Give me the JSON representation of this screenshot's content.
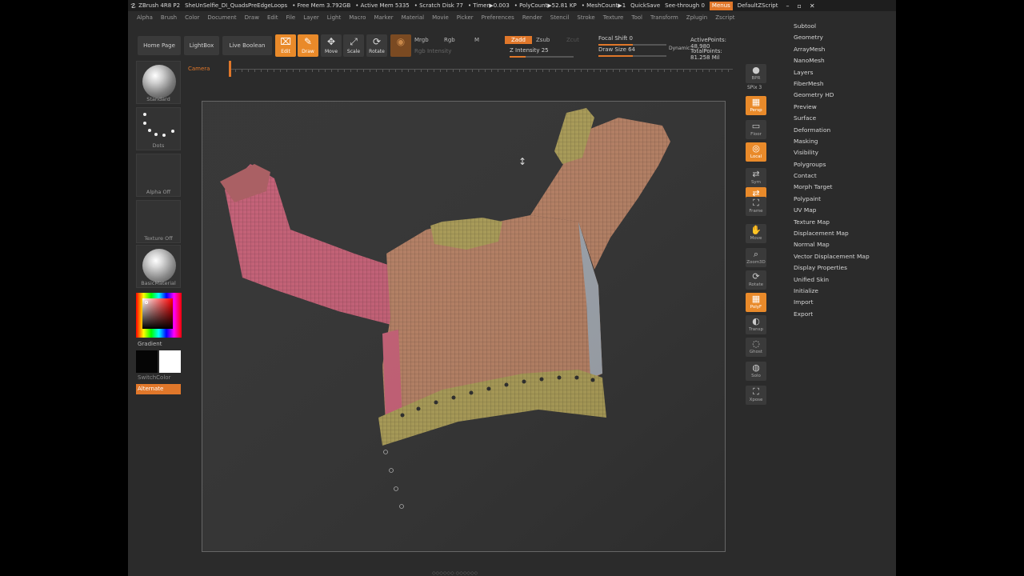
{
  "titlebar": {
    "app": "ZBrush 4R8 P2",
    "file": "SheUnSelfie_DI_QuadsPreEdgeLoops",
    "free_mem": "• Free Mem 3.792GB",
    "active_mem": "• Active Mem 5335",
    "scratch": "• Scratch Disk 77",
    "timer": "• Timer▶0.003",
    "polycount": "• PolyCount▶52.81 KP",
    "meshcount": "• MeshCount▶1",
    "quicksave": "QuickSave",
    "see_through": "See-through  0",
    "menus": "Menus",
    "script": "DefaultZScript"
  },
  "menubar": [
    "Alpha",
    "Brush",
    "Color",
    "Document",
    "Draw",
    "Edit",
    "File",
    "Layer",
    "Light",
    "Macro",
    "Marker",
    "Material",
    "Movie",
    "Picker",
    "Preferences",
    "Render",
    "Stencil",
    "Stroke",
    "Texture",
    "Tool",
    "Transform",
    "Zplugin",
    "Zscript"
  ],
  "toolbar": {
    "home_page": "Home Page",
    "lightbox": "LightBox",
    "live_boolean": "Live Boolean",
    "edit": "Edit",
    "draw": "Draw",
    "move": "Move",
    "scale": "Scale",
    "rotate": "Rotate",
    "mrgb": "Mrgb",
    "rgb": "Rgb",
    "m": "M",
    "rgb_intensity": "Rgb Intensity",
    "zadd": "Zadd",
    "zsub": "Zsub",
    "zcut": "Zcut",
    "z_intensity": "Z Intensity 25",
    "focal_shift": "Focal Shift 0",
    "draw_size": "Draw Size 64",
    "dynamic": "Dynamic",
    "active_points": "ActivePoints: 48,980",
    "total_points": "TotalPoints: 81.258 Mil"
  },
  "progress": {
    "z_intensity": 0.25,
    "draw_size": 0.5,
    "focal_shift": 0.5
  },
  "camera": {
    "label": "Camera"
  },
  "left_shelf": {
    "brush": "Standard",
    "stroke": "Dots",
    "alpha": "Alpha Off",
    "texture": "Texture Off",
    "material": "BasicMaterial",
    "gradient": "Gradient",
    "switch_color": "SwitchColor",
    "alternate": "Alternate"
  },
  "right_shelf": [
    {
      "label": "BPR",
      "icon": "sphere-icon"
    },
    {
      "label": "SPix 3",
      "icon": ""
    },
    {
      "label": "Persp",
      "icon": "persp-icon"
    },
    {
      "label": "Floor",
      "icon": "floor-icon"
    },
    {
      "label": "Local",
      "icon": "local-icon"
    },
    {
      "label": "Sym",
      "icon": "xyz-icon"
    },
    {
      "label": "Qxyz",
      "icon": "xyz-icon"
    },
    {
      "label": "Frame",
      "icon": "frame-icon"
    },
    {
      "label": "Move",
      "icon": "hand-icon"
    },
    {
      "label": "Zoom3D",
      "icon": "zoom-icon"
    },
    {
      "label": "Rotate",
      "icon": "rotate-icon"
    },
    {
      "label": "PolyF",
      "icon": "polyframe-icon"
    },
    {
      "label": "Transp",
      "icon": "transp-icon"
    },
    {
      "label": "Ghost",
      "icon": "ghost-icon"
    },
    {
      "label": "Solo",
      "icon": "solo-icon"
    },
    {
      "label": "Xpose",
      "icon": "xpose-icon"
    }
  ],
  "tool_panel": [
    "Subtool",
    "Geometry",
    "ArrayMesh",
    "NanoMesh",
    "Layers",
    "FiberMesh",
    "Geometry HD",
    "Preview",
    "Surface",
    "Deformation",
    "Masking",
    "Visibility",
    "Polygroups",
    "Contact",
    "Morph Target",
    "Polypaint",
    "UV Map",
    "Texture Map",
    "Displacement Map",
    "Normal Map",
    "Vector Displacement Map",
    "Display Properties",
    "Unified Skin",
    "Initialize",
    "Import",
    "Export"
  ],
  "colors": {
    "accent": "#e0772a",
    "bg": "#2b2b2b",
    "jacket_main": "#b47e62",
    "jacket_sleeve_left": "#c25d73",
    "trim": "#a89a55"
  }
}
